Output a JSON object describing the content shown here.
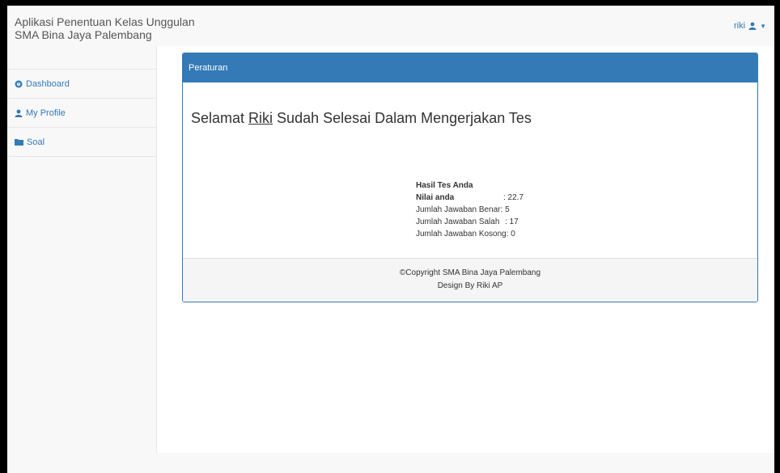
{
  "navbar": {
    "brand_line1": "Aplikasi Penentuan Kelas Unggulan",
    "brand_line2": "SMA Bina Jaya Palembang",
    "user_name": "riki",
    "user_icon": "user-icon",
    "caret_icon": "caret-down-icon"
  },
  "sidebar": {
    "items": [
      {
        "label": "Dashboard",
        "icon": "dashboard-icon"
      },
      {
        "label": "My Profile",
        "icon": "user-icon"
      },
      {
        "label": "Soal",
        "icon": "folder-icon"
      }
    ]
  },
  "panel": {
    "heading": "Peraturan",
    "headline_pre": "Selamat ",
    "headline_name": "Riki",
    "headline_post": " Sudah Selesai Dalam Mengerjakan Tes",
    "results": {
      "title": "Hasil Tes Anda",
      "score_label": "Nilai anda",
      "score_value": ": 22.7",
      "correct_label": "Jumlah Jawaban Benar",
      "correct_value": ": 5",
      "wrong_label": "Jumlah Jawaban Salah",
      "wrong_value": ": 17",
      "empty_label": "Jumlah Jawaban Kosong",
      "empty_value": ": 0"
    },
    "footer_line1": "©Copyright SMA Bina Jaya Palembang",
    "footer_line2": "Design By Riki AP"
  },
  "colors": {
    "primary": "#337ab7",
    "sidebar_bg": "#f8f8f8",
    "panel_footer_bg": "#f5f5f5"
  }
}
